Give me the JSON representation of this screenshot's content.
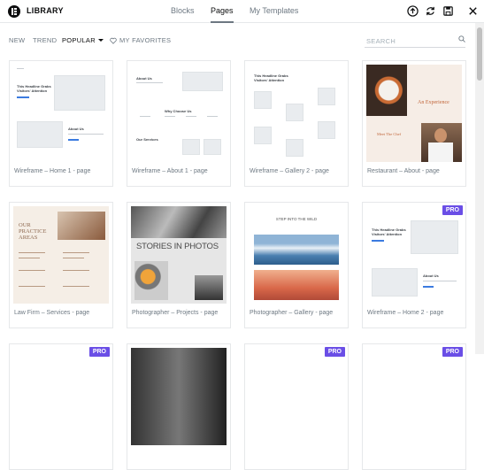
{
  "header": {
    "brand": "LIBRARY",
    "tabs": [
      {
        "label": "Blocks",
        "active": false
      },
      {
        "label": "Pages",
        "active": true
      },
      {
        "label": "My Templates",
        "active": false
      }
    ],
    "icons": [
      "upload-icon",
      "sync-icon",
      "save-icon",
      "close-icon"
    ]
  },
  "filters": {
    "items": [
      {
        "label": "NEW"
      },
      {
        "label": "TREND"
      },
      {
        "label": "POPULAR"
      },
      {
        "label": "MY FAVORITES"
      }
    ],
    "search_placeholder": "SEARCH"
  },
  "cards": [
    {
      "title": "Wireframe – Home 1 - page",
      "pro": false,
      "thumb": {
        "headline": "This Headline Grabs Visitors' Attention",
        "about": "About Us"
      }
    },
    {
      "title": "Wireframe – About 1 - page",
      "pro": false,
      "thumb": {
        "about": "About Us",
        "why": "Why Choose Us",
        "services": "Our Services"
      }
    },
    {
      "title": "Wireframe – Gallery 2 - page",
      "pro": false,
      "thumb": {
        "headline": "This Headline Grabs Visitors' Attention"
      }
    },
    {
      "title": "Restaurant – About - page",
      "pro": false,
      "thumb": {
        "experience": "An Experience",
        "chef": "Meet The Chef"
      }
    },
    {
      "title": "Law Firm – Services - page",
      "pro": false,
      "thumb": {
        "heading": "OUR PRACTICE AREAS"
      }
    },
    {
      "title": "Photographer – Projects - page",
      "pro": false,
      "thumb": {
        "heading": "STORIES IN PHOTOS"
      }
    },
    {
      "title": "Photographer – Gallery - page",
      "pro": false,
      "thumb": {
        "heading": "STEP INTO THE WILD"
      }
    },
    {
      "title": "Wireframe – Home 2 - page",
      "pro": true,
      "thumb": {
        "headline": "This Headline Grabs Visitors' Attention",
        "about": "About Us"
      }
    }
  ],
  "pro_label": "PRO",
  "colors": {
    "accent": "#6a4ee6",
    "text": "#6d7882",
    "dark": "#0c0d0e"
  }
}
